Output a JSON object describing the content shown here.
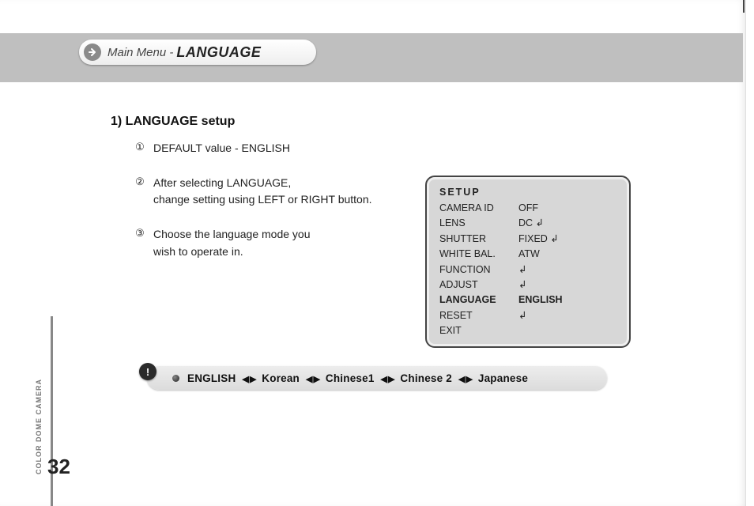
{
  "title": {
    "prefix": "Main Menu - ",
    "main": "LANGUAGE"
  },
  "heading": "1)  LANGUAGE setup",
  "steps": [
    {
      "num": "①",
      "lines": [
        "DEFAULT value - ENGLISH"
      ]
    },
    {
      "num": "②",
      "lines": [
        "After selecting LANGUAGE,",
        "change setting using LEFT or RIGHT button."
      ]
    },
    {
      "num": "③",
      "lines": [
        "Choose the language mode you",
        "wish to operate in."
      ]
    }
  ],
  "setup": {
    "title": "SETUP",
    "rows": [
      {
        "k": "CAMERA ID",
        "v": "OFF",
        "enter": false,
        "sel": false
      },
      {
        "k": "LENS",
        "v": "DC",
        "enter": true,
        "sel": false
      },
      {
        "k": "SHUTTER",
        "v": "FIXED",
        "enter": true,
        "sel": false
      },
      {
        "k": "WHITE BAL.",
        "v": "ATW",
        "enter": false,
        "sel": false
      },
      {
        "k": "FUNCTION",
        "v": "",
        "enter": true,
        "sel": false
      },
      {
        "k": "ADJUST",
        "v": "",
        "enter": true,
        "sel": false
      },
      {
        "k": "LANGUAGE",
        "v": "ENGLISH",
        "enter": false,
        "sel": true
      },
      {
        "k": "RESET",
        "v": "",
        "enter": true,
        "sel": false
      },
      {
        "k": "EXIT",
        "v": "",
        "enter": false,
        "sel": false
      }
    ]
  },
  "enter_glyph": "↲",
  "note": {
    "badge": "!",
    "arrows": "◀ ▶",
    "items": [
      "ENGLISH",
      "Korean",
      "Chinese1",
      "Chinese 2",
      "Japanese"
    ]
  },
  "side_label": "COLOR DOME CAMERA",
  "page_number": "32"
}
